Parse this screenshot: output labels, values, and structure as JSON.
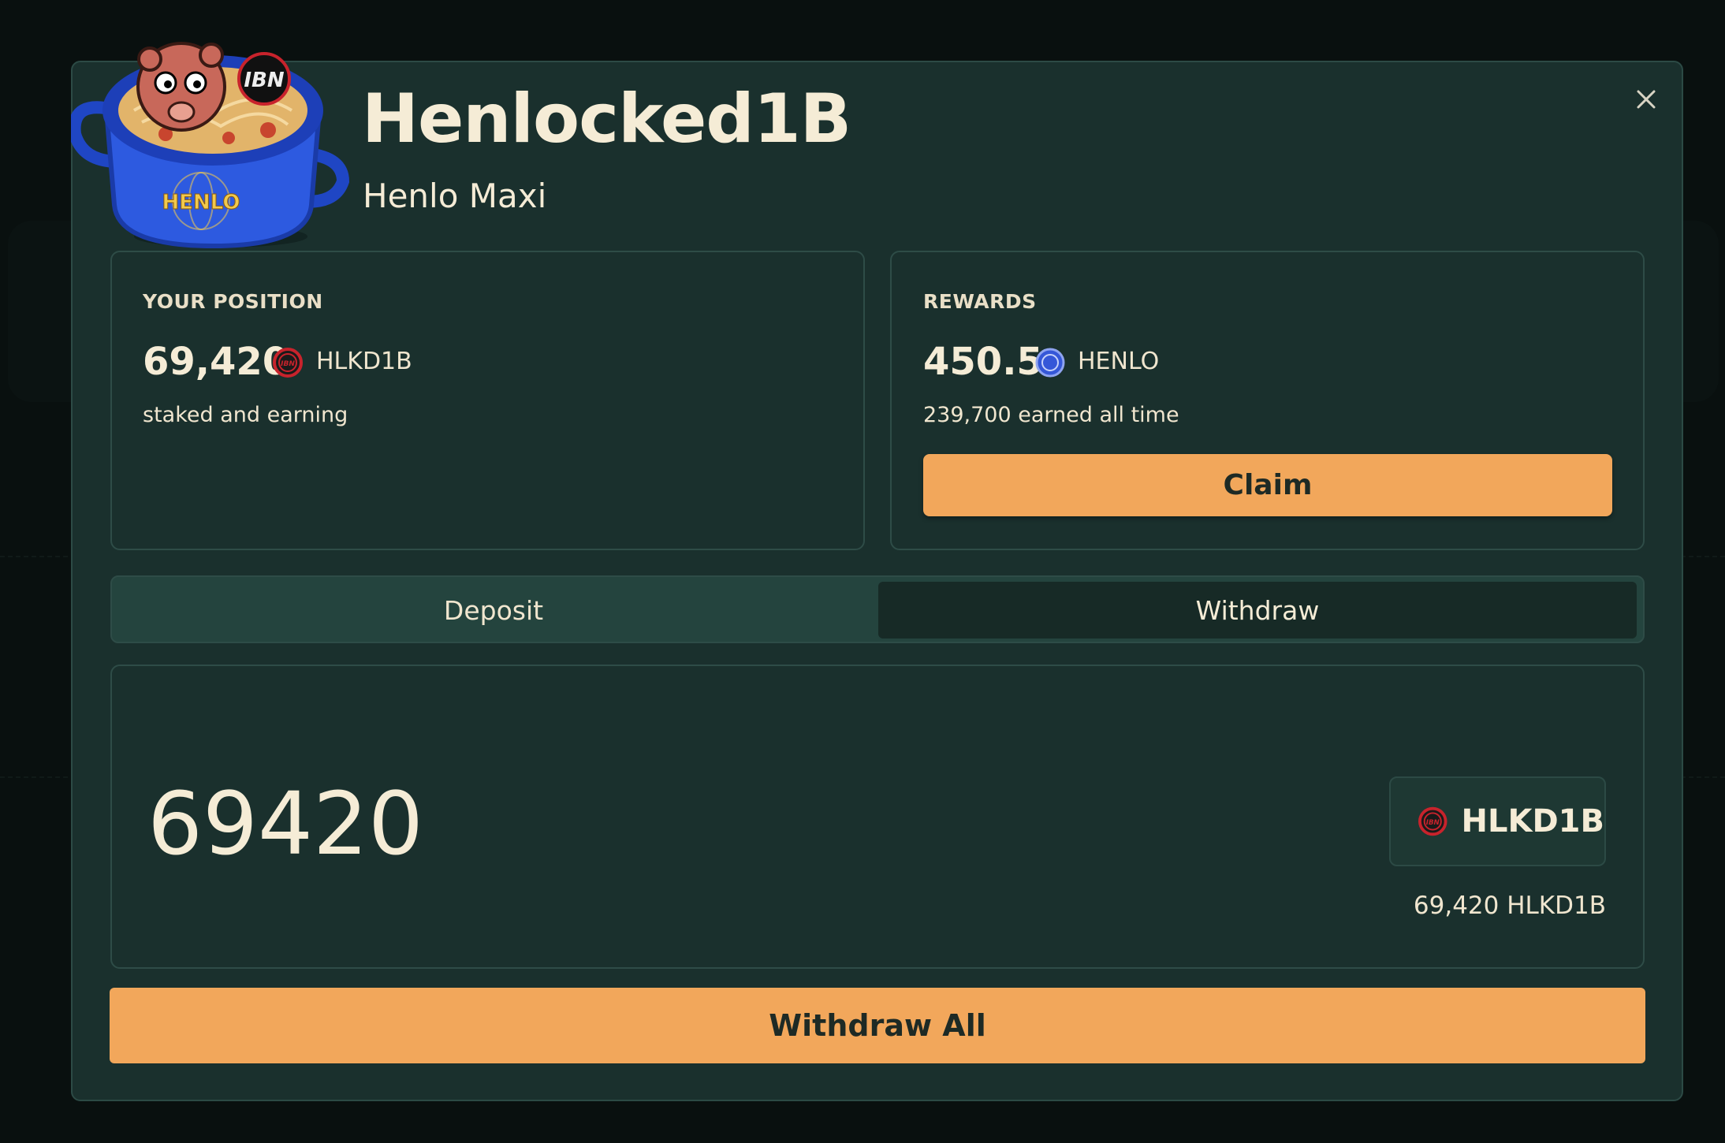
{
  "modal": {
    "title": "Henlocked1B",
    "subtitle": "Henlo Maxi"
  },
  "position": {
    "label": "YOUR POSITION",
    "amount": "69,420",
    "ticker": "HLKD1B",
    "note": "staked and earning"
  },
  "rewards": {
    "label": "REWARDS",
    "amount": "450.5",
    "ticker": "HENLO",
    "note": "239,700 earned all time",
    "claim_label": "Claim"
  },
  "tabs": [
    {
      "label": "Deposit",
      "active": false
    },
    {
      "label": "Withdraw",
      "active": true
    }
  ],
  "withdraw": {
    "amount_value": "69420",
    "token": "HLKD1B",
    "balance": "69,420 HLKD1B",
    "submit_label": "Withdraw All"
  },
  "artwork": {
    "pot_label": "HENLO",
    "badge_label": "IBN"
  },
  "colors": {
    "modal_bg": "#1a302d",
    "accent": "#f2a75b",
    "text": "#f5ecd6",
    "hlkd_coin": "#c8232c",
    "henlo_coin": "#3557d8"
  },
  "icons": {
    "close": "close-icon",
    "hlkd": "hlkd1b-token-icon",
    "henlo": "henlo-token-icon"
  }
}
